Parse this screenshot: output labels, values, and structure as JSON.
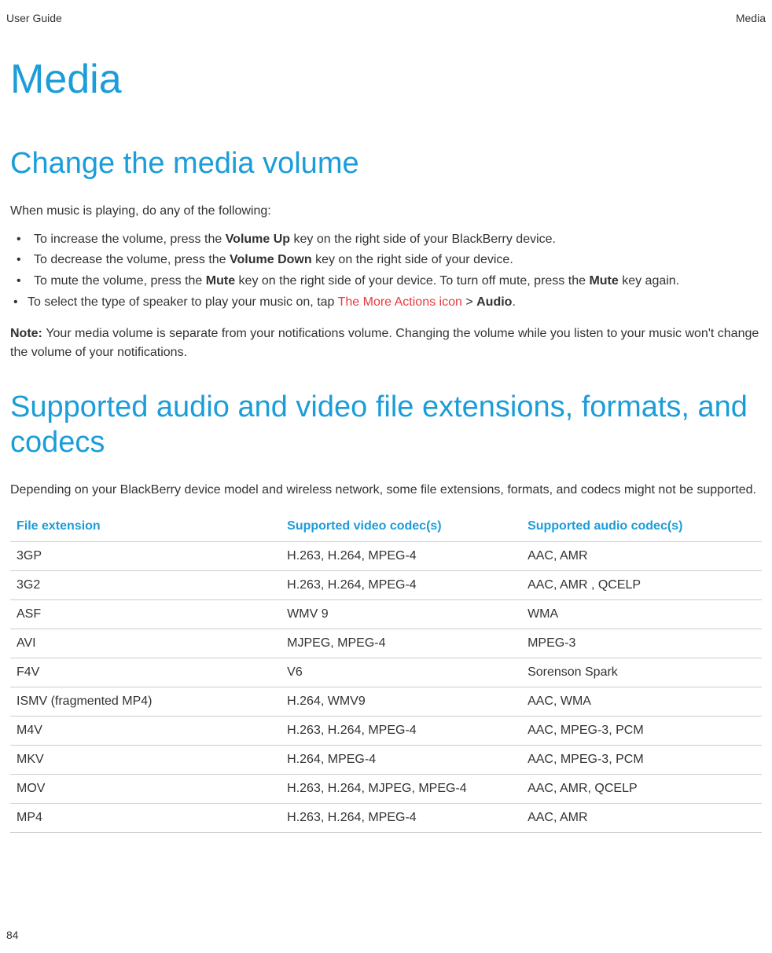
{
  "header": {
    "left": "User Guide",
    "right": "Media"
  },
  "page_title": "Media",
  "section1": {
    "heading": "Change the media volume",
    "intro": "When music is playing, do any of the following:",
    "bullets": {
      "b1": {
        "pre": "To increase the volume, press the ",
        "bold": "Volume Up",
        "post": " key on the right side of your BlackBerry device."
      },
      "b2": {
        "pre": "To decrease the volume, press the ",
        "bold": "Volume Down",
        "post": " key on the right side of your device."
      },
      "b3": {
        "pre": "To mute the volume, press the ",
        "bold1": "Mute",
        "mid": " key on the right side of your device. To turn off mute, press the ",
        "bold2": "Mute",
        "post": " key again."
      },
      "b4": {
        "pre": "To select the type of speaker to play your music on, tap  ",
        "link": "The More Actions icon",
        "mid": "  > ",
        "bold": "Audio",
        "post": "."
      }
    },
    "note": {
      "label": "Note: ",
      "text": "Your media volume is separate from your notifications volume. Changing the volume while you listen to your music won't change the volume of your notifications."
    }
  },
  "section2": {
    "heading": "Supported audio and video file extensions, formats, and codecs",
    "intro": "Depending on your BlackBerry device model and wireless network, some file extensions, formats, and codecs might not be supported.",
    "table": {
      "headers": {
        "c1": "File extension",
        "c2": "Supported video codec(s)",
        "c3": "Supported audio codec(s)"
      },
      "rows": [
        {
          "c1": "3GP",
          "c2": "H.263, H.264, MPEG-4",
          "c3": "AAC, AMR"
        },
        {
          "c1": "3G2",
          "c2": "H.263, H.264, MPEG-4",
          "c3": "AAC, AMR , QCELP"
        },
        {
          "c1": "ASF",
          "c2": "WMV 9",
          "c3": "WMA"
        },
        {
          "c1": "AVI",
          "c2": "MJPEG, MPEG-4",
          "c3": "MPEG-3"
        },
        {
          "c1": "F4V",
          "c2": "V6",
          "c3": "Sorenson Spark"
        },
        {
          "c1": "ISMV (fragmented MP4)",
          "c2": "H.264, WMV9",
          "c3": "AAC, WMA"
        },
        {
          "c1": "M4V",
          "c2": "H.263, H.264, MPEG-4",
          "c3": "AAC, MPEG-3, PCM"
        },
        {
          "c1": "MKV",
          "c2": "H.264, MPEG-4",
          "c3": "AAC, MPEG-3, PCM"
        },
        {
          "c1": "MOV",
          "c2": "H.263, H.264, MJPEG, MPEG-4",
          "c3": "AAC, AMR, QCELP"
        },
        {
          "c1": "MP4",
          "c2": "H.263, H.264, MPEG-4",
          "c3": "AAC, AMR"
        }
      ]
    }
  },
  "page_number": "84"
}
